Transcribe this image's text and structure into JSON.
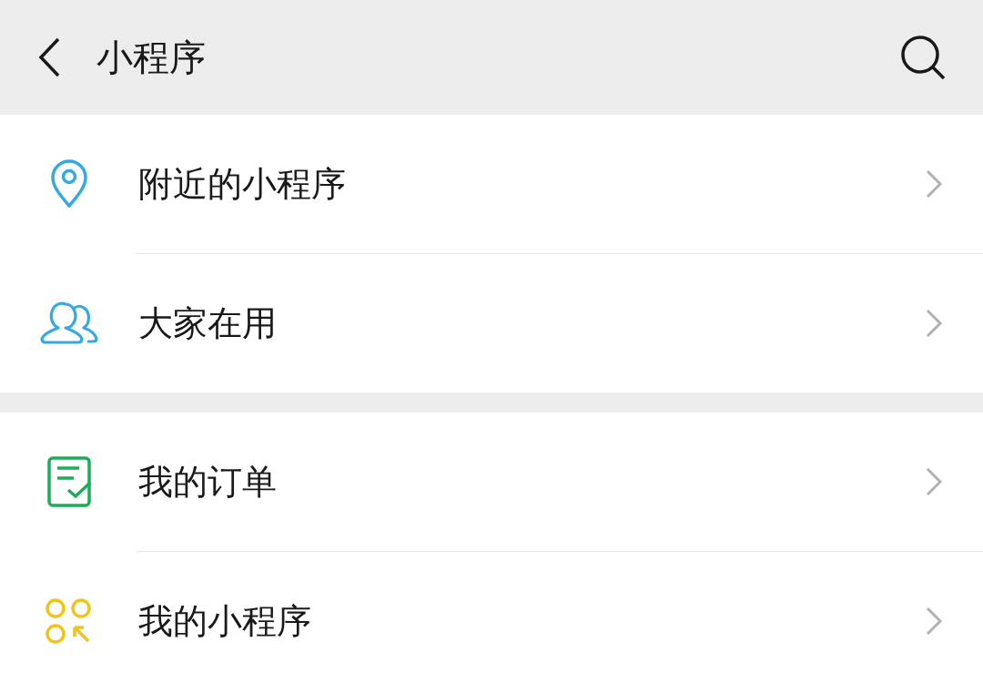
{
  "header": {
    "title": "小程序"
  },
  "sections": [
    {
      "items": [
        {
          "kind": "location",
          "label": "附近的小程序"
        },
        {
          "kind": "people",
          "label": "大家在用"
        }
      ]
    },
    {
      "items": [
        {
          "kind": "order",
          "label": "我的订单"
        },
        {
          "kind": "apps",
          "label": "我的小程序"
        }
      ]
    }
  ]
}
